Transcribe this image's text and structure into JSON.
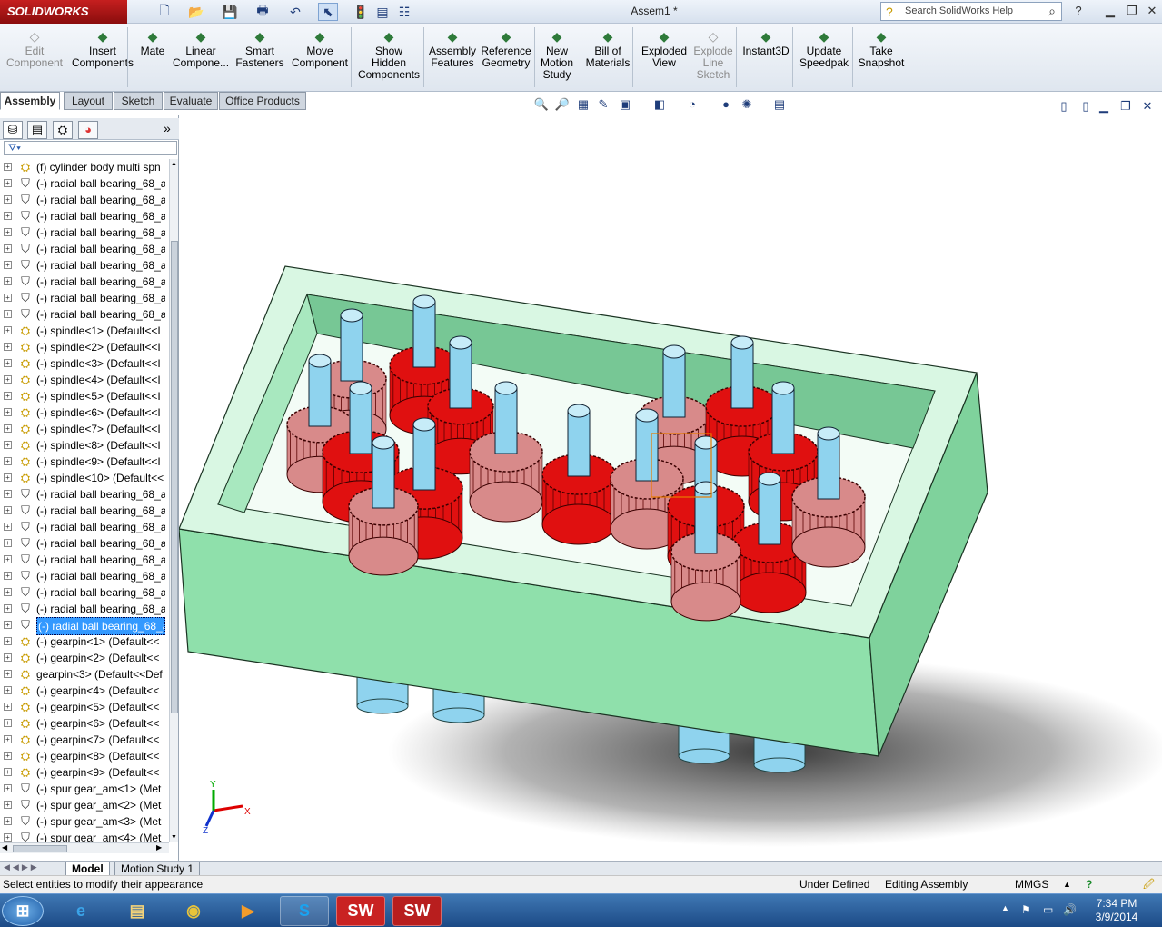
{
  "app": {
    "logo": "SOLIDWORKS",
    "doc_title": "Assem1 *"
  },
  "search": {
    "placeholder": "Search SolidWorks Help"
  },
  "command_manager": [
    {
      "label": "Edit\nComponent",
      "icon": "edit-component-icon",
      "disabled": true
    },
    {
      "label": "Insert\nComponents",
      "icon": "insert-components-icon"
    },
    {
      "label": "Mate",
      "icon": "mate-icon"
    },
    {
      "label": "Linear\nCompone...",
      "icon": "linear-pattern-icon"
    },
    {
      "label": "Smart\nFasteners",
      "icon": "smart-fasteners-icon"
    },
    {
      "label": "Move\nComponent",
      "icon": "move-component-icon"
    },
    {
      "label": "Show\nHidden\nComponents",
      "icon": "show-hidden-icon"
    },
    {
      "label": "Assembly\nFeatures",
      "icon": "assembly-features-icon"
    },
    {
      "label": "Reference\nGeometry",
      "icon": "reference-geometry-icon"
    },
    {
      "label": "New\nMotion\nStudy",
      "icon": "motion-study-icon"
    },
    {
      "label": "Bill of\nMaterials",
      "icon": "bom-icon"
    },
    {
      "label": "Exploded\nView",
      "icon": "exploded-view-icon"
    },
    {
      "label": "Explode\nLine\nSketch",
      "icon": "explode-line-icon",
      "disabled": true
    },
    {
      "label": "Instant3D",
      "icon": "instant3d-icon"
    },
    {
      "label": "Update\nSpeedpak",
      "icon": "speedpak-icon"
    },
    {
      "label": "Take\nSnapshot",
      "icon": "snapshot-icon"
    }
  ],
  "tabs": [
    "Assembly",
    "Layout",
    "Sketch",
    "Evaluate",
    "Office Products"
  ],
  "tree": [
    {
      "label": "(f) cylinder body multi spn",
      "type": "part"
    },
    {
      "label": "(-) radial ball bearing_68_a",
      "type": "bearing"
    },
    {
      "label": "(-) radial ball bearing_68_a",
      "type": "bearing"
    },
    {
      "label": "(-) radial ball bearing_68_a",
      "type": "bearing"
    },
    {
      "label": "(-) radial ball bearing_68_a",
      "type": "bearing"
    },
    {
      "label": "(-) radial ball bearing_68_a",
      "type": "bearing"
    },
    {
      "label": "(-) radial ball bearing_68_a",
      "type": "bearing"
    },
    {
      "label": "(-) radial ball bearing_68_a",
      "type": "bearing"
    },
    {
      "label": "(-) radial ball bearing_68_a",
      "type": "bearing"
    },
    {
      "label": "(-) radial ball bearing_68_a",
      "type": "bearing"
    },
    {
      "label": "(-) spindle<1> (Default<<I",
      "type": "part"
    },
    {
      "label": "(-) spindle<2> (Default<<I",
      "type": "part"
    },
    {
      "label": "(-) spindle<3> (Default<<I",
      "type": "part"
    },
    {
      "label": "(-) spindle<4> (Default<<I",
      "type": "part"
    },
    {
      "label": "(-) spindle<5> (Default<<I",
      "type": "part"
    },
    {
      "label": "(-) spindle<6> (Default<<I",
      "type": "part"
    },
    {
      "label": "(-) spindle<7> (Default<<I",
      "type": "part"
    },
    {
      "label": "(-) spindle<8> (Default<<I",
      "type": "part"
    },
    {
      "label": "(-) spindle<9> (Default<<I",
      "type": "part"
    },
    {
      "label": "(-) spindle<10> (Default<<",
      "type": "part"
    },
    {
      "label": "(-) radial ball bearing_68_a",
      "type": "bearing"
    },
    {
      "label": "(-) radial ball bearing_68_a",
      "type": "bearing"
    },
    {
      "label": "(-) radial ball bearing_68_a",
      "type": "bearing"
    },
    {
      "label": "(-) radial ball bearing_68_a",
      "type": "bearing"
    },
    {
      "label": "(-) radial ball bearing_68_a",
      "type": "bearing"
    },
    {
      "label": "(-) radial ball bearing_68_a",
      "type": "bearing"
    },
    {
      "label": "(-) radial ball bearing_68_a",
      "type": "bearing"
    },
    {
      "label": "(-) radial ball bearing_68_a",
      "type": "bearing"
    },
    {
      "label": "(-) radial ball bearing_68_a",
      "type": "bearing",
      "selected": true
    },
    {
      "label": "(-) gearpin<1> (Default<<",
      "type": "part"
    },
    {
      "label": "(-) gearpin<2> (Default<<",
      "type": "part"
    },
    {
      "label": "gearpin<3> (Default<<Def",
      "type": "part"
    },
    {
      "label": "(-) gearpin<4> (Default<<",
      "type": "part"
    },
    {
      "label": "(-) gearpin<5> (Default<<",
      "type": "part"
    },
    {
      "label": "(-) gearpin<6> (Default<<",
      "type": "part"
    },
    {
      "label": "(-) gearpin<7> (Default<<",
      "type": "part"
    },
    {
      "label": "(-) gearpin<8> (Default<<",
      "type": "part"
    },
    {
      "label": "(-) gearpin<9> (Default<<",
      "type": "part"
    },
    {
      "label": "(-) spur gear_am<1> (Met",
      "type": "bearing"
    },
    {
      "label": "(-) spur gear_am<2> (Met",
      "type": "bearing"
    },
    {
      "label": "(-) spur gear_am<3> (Met",
      "type": "bearing"
    },
    {
      "label": "(-) spur gear_am<4> (Met",
      "type": "bearing"
    }
  ],
  "bottom_tabs": [
    "Model",
    "Motion Study 1"
  ],
  "status": {
    "hint": "Select entities to modify their appearance",
    "defined": "Under Defined",
    "mode": "Editing Assembly",
    "units": "MMGS"
  },
  "triad": {
    "x": "X",
    "y": "Y",
    "z": "Z"
  },
  "taskbar": {
    "time": "7:34 PM",
    "date": "3/9/2014",
    "sw_label": "SW"
  },
  "colors": {
    "box": "#a8e8bf",
    "box_inner": "#d9f7e3",
    "gear_red": "#e01010",
    "gear_pink": "#d88a8a",
    "shaft": "#8fd3ee",
    "selection": "#3399ff"
  }
}
